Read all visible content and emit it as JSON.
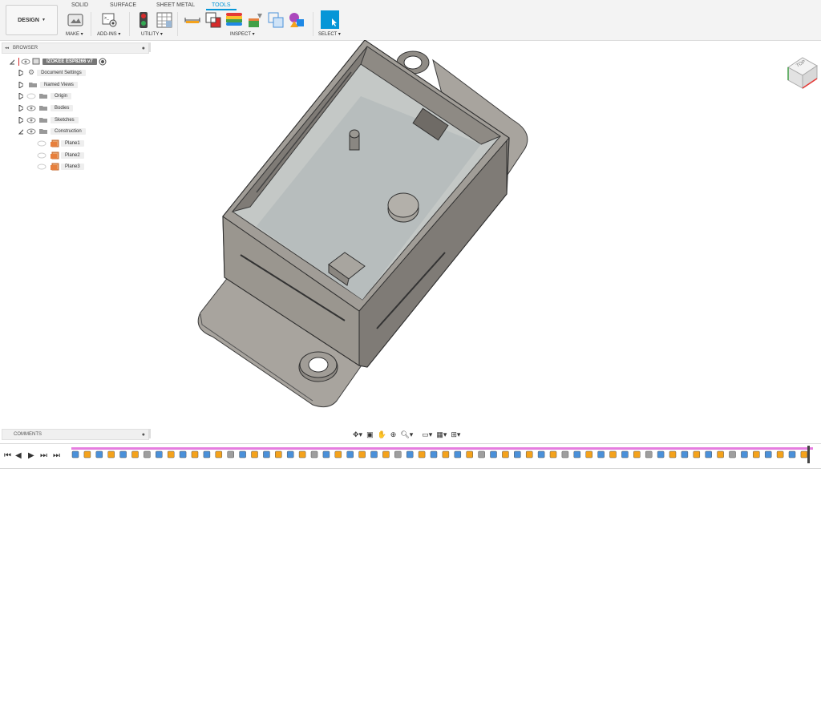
{
  "workspace": {
    "label": "DESIGN"
  },
  "tabs": [
    {
      "label": "SOLID"
    },
    {
      "label": "SURFACE"
    },
    {
      "label": "SHEET METAL"
    },
    {
      "label": "TOOLS"
    }
  ],
  "groups": {
    "make": "MAKE",
    "addins": "ADD-INS",
    "utility": "UTILITY",
    "inspect": "INSPECT",
    "select": "SELECT"
  },
  "browser": {
    "title": "BROWSER",
    "root": "IZOKEE ESP8266 v7",
    "items": [
      {
        "label": "Document Settings",
        "icon": "gear-icon"
      },
      {
        "label": "Named Views",
        "icon": "folder-icon"
      },
      {
        "label": "Origin",
        "icon": "folder-icon"
      },
      {
        "label": "Bodies",
        "icon": "folder-icon"
      },
      {
        "label": "Sketches",
        "icon": "folder-icon"
      },
      {
        "label": "Construction",
        "icon": "folder-icon"
      }
    ],
    "planes": [
      {
        "label": "Plane1"
      },
      {
        "label": "Plane2"
      },
      {
        "label": "Plane3"
      }
    ]
  },
  "comments": {
    "title": "COMMENTS"
  },
  "viewcube": {
    "face": "TOP"
  },
  "colors": {
    "accent": "#0696d7",
    "body": "#9e9a94",
    "floor": "#b7bdbd"
  }
}
